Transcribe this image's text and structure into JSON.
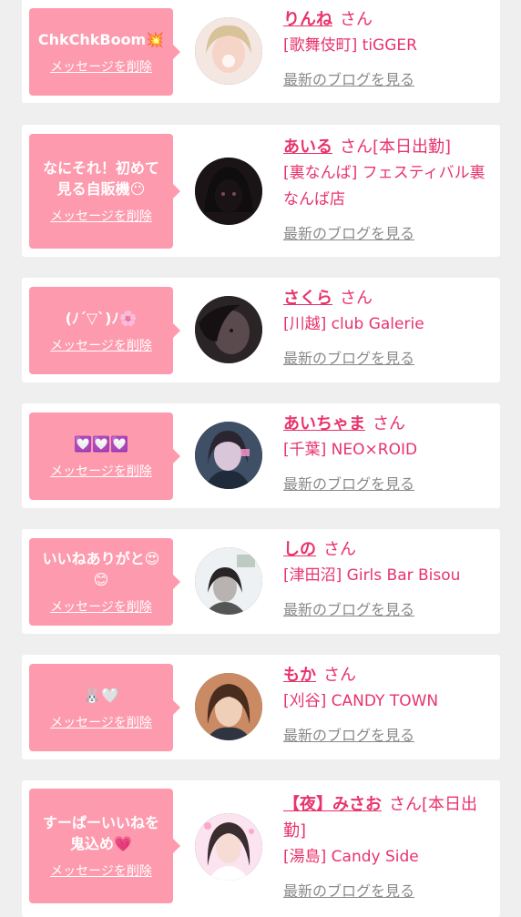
{
  "labels": {
    "delete": "メッセージを削除",
    "blog": "最新のブログを見る",
    "san": "さん"
  },
  "cards": [
    {
      "message": "ChkChkBoom💥",
      "name": "りんね",
      "suffix": "",
      "shop": "[歌舞伎町] tiGGER"
    },
    {
      "message": "なにそれ！初めて\n見る自販機😶",
      "name": "あいる",
      "suffix": "[本日出勤]",
      "shop": "[裏なんば] フェスティバル裏なんば店"
    },
    {
      "message": "(ﾉ´▽`)ﾉ🌸",
      "name": "さくら",
      "suffix": "",
      "shop": "[川越] club Galerie"
    },
    {
      "message": "💟💟💟",
      "name": "あいちゃま",
      "suffix": "",
      "shop": "[千葉] NEO×ROID"
    },
    {
      "message": "いいねありがと😍\n😊",
      "name": "しの",
      "suffix": "",
      "shop": "[津田沼] Girls Bar Bisou"
    },
    {
      "message": "🐰🤍",
      "name": "もか",
      "suffix": "",
      "shop": "[刈谷] CANDY TOWN"
    },
    {
      "message": "すーぱーいいねを\n鬼込め💗",
      "name": "【夜】みさお",
      "suffix": "[本日出勤]",
      "shop": "[湯島] Candy Side"
    }
  ],
  "colors": {
    "bubble": "#fd9aae",
    "accent": "#e8336c",
    "link_gray": "#8a8a8a",
    "background": "#efefef"
  }
}
